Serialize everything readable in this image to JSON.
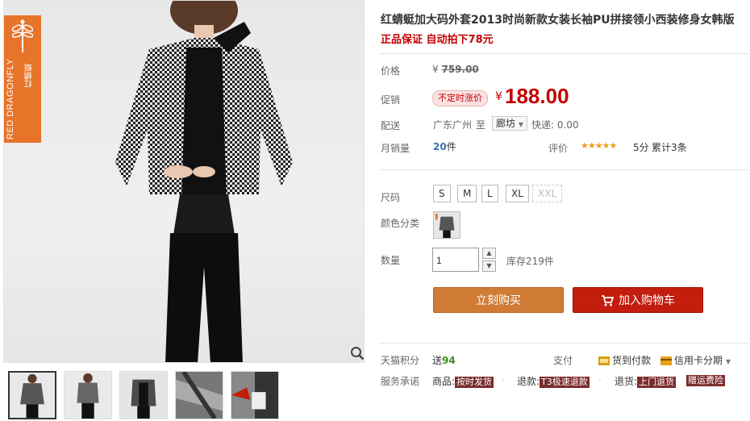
{
  "brand": {
    "en": "RED DRAGONFLY",
    "cn": "红蜻蜓"
  },
  "product": {
    "title": "红蜻蜓加大码外套2013时尚新款女装长袖PU拼接领小西装修身女韩版",
    "subtitle": "正品保证 自动拍下78元"
  },
  "price": {
    "label": "价格",
    "symbol": "¥",
    "original": "759.00",
    "promo_label": "促销",
    "promo_tag": "不定时涨价",
    "promo_symbol": "¥",
    "promo_value": "188.00"
  },
  "shipping": {
    "label": "配送",
    "from": "广东广州",
    "to_word": "至",
    "city": "廊坊",
    "express": "快递: 0.00"
  },
  "sales": {
    "label": "月销量",
    "count": "20",
    "unit": "件",
    "rating_label": "评价",
    "stars": "★★★★★",
    "score": "5分",
    "total": "累计3条"
  },
  "sku": {
    "size_label": "尺码",
    "sizes": [
      "S",
      "M",
      "L",
      "XL",
      "XXL"
    ],
    "color_label": "颜色分类"
  },
  "quantity": {
    "label": "数量",
    "value": "1",
    "stock": "库存219件"
  },
  "buttons": {
    "buy": "立刻购买",
    "cart": "加入购物车"
  },
  "services": {
    "points_label": "天猫积分",
    "points_send": "送",
    "points_value": "94",
    "pay_label": "支付",
    "cod": "货到付款",
    "credit": "信用卡分期",
    "promise_label": "服务承诺",
    "goods": "商品:",
    "goods_badge": "按时发货",
    "return1": "退款:",
    "return1_badge": "T3极速退款",
    "return2": "退货:",
    "return2_badge": "上门退货",
    "extra_badge": "赠运费险"
  },
  "colors": {
    "price_red": "#c40000",
    "buy_btn": "#d07b36",
    "cart_btn": "#c21d0d",
    "brand_orange": "#e8742a"
  }
}
